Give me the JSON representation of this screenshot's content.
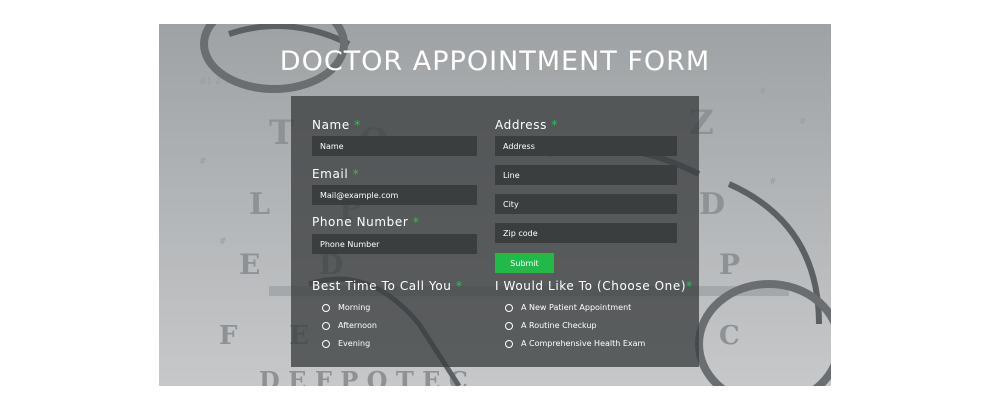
{
  "title": "DOCTOR APPOINTMENT FORM",
  "left": {
    "name_label": "Name",
    "name_placeholder": "Name",
    "email_label": "Email",
    "email_placeholder": "Mail@example.com",
    "phone_label": "Phone Number",
    "phone_placeholder": "Phone Number"
  },
  "right": {
    "address_label": "Address",
    "address_placeholder": "Address",
    "line_placeholder": "Line",
    "city_placeholder": "City",
    "zip_placeholder": "Zip code"
  },
  "required_mark": "*",
  "submit_label": "Submit",
  "best_time": {
    "label": "Best Time To Call You",
    "options": [
      "Morning",
      "Afternoon",
      "Evening"
    ]
  },
  "would_like": {
    "label": "I Would Like To (Choose One)",
    "options": [
      "A New Patient Appointment",
      "A Routine Checkup",
      "A Comprehensive Health Exam"
    ]
  },
  "colors": {
    "accent": "#22b84a",
    "required": "#2ec24f",
    "panel": "#3c3f40"
  },
  "icons": {
    "radio": "radio-circle-icon"
  }
}
